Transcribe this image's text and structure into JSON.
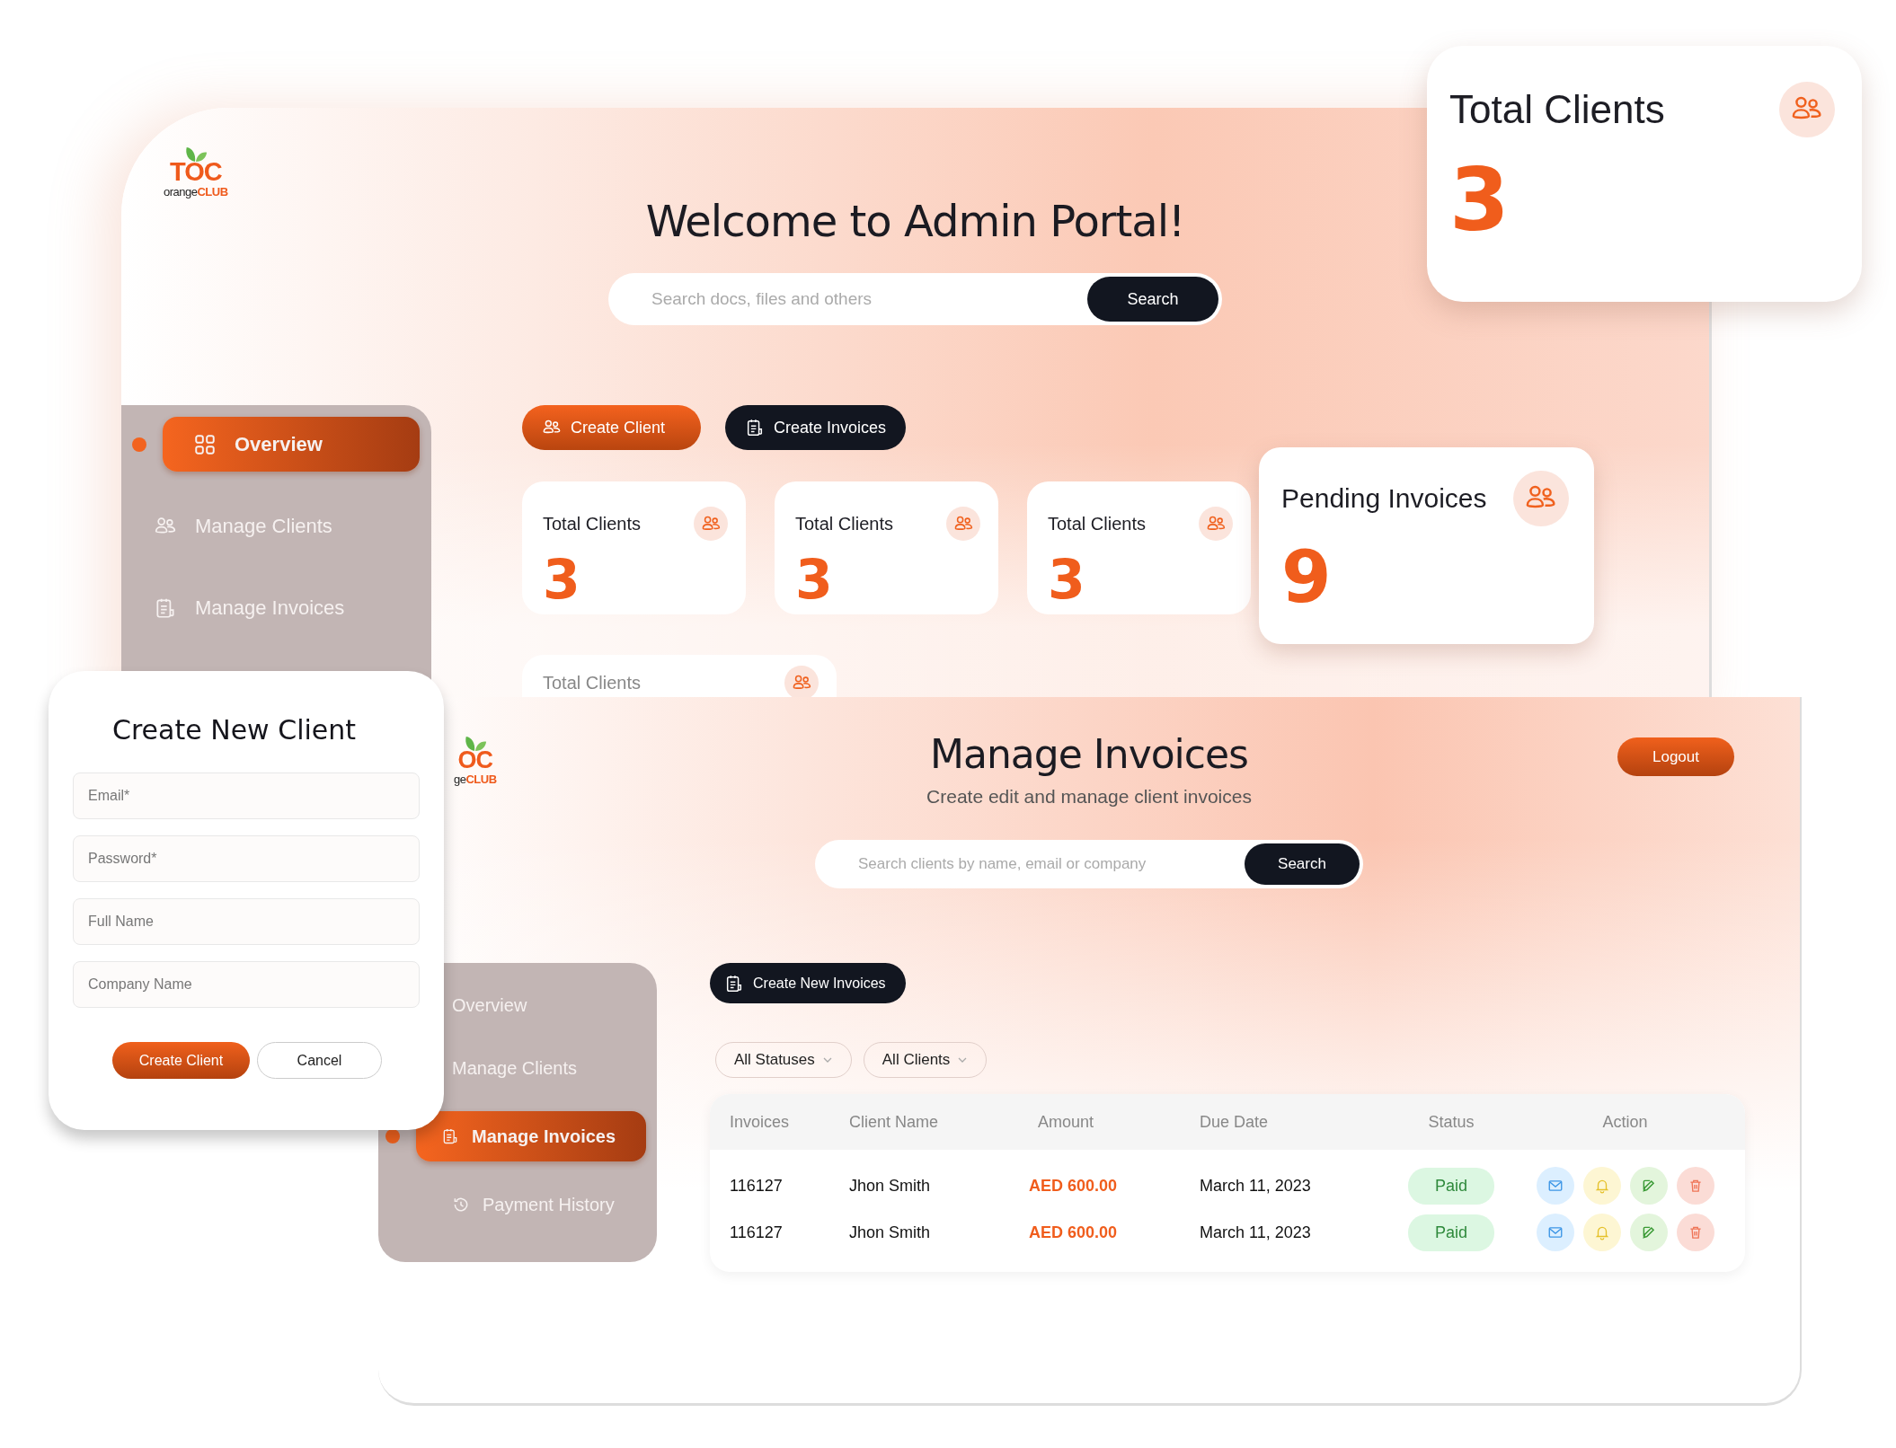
{
  "admin_portal": {
    "logo": {
      "mark": "TOC",
      "name": "orange",
      "name_accent": "CLUB"
    },
    "title": "Welcome to Admin Portal!",
    "search": {
      "placeholder": "Search docs, files and others",
      "button": "Search"
    },
    "sidebar": {
      "items": [
        {
          "label": "Overview",
          "selected": true
        },
        {
          "label": "Manage Clients",
          "selected": false
        },
        {
          "label": "Manage Invoices",
          "selected": false
        }
      ]
    },
    "actions": [
      {
        "label": "Create Client",
        "kind": "primary"
      },
      {
        "label": "Create Invoices",
        "kind": "dark"
      }
    ],
    "stat_cards": [
      {
        "label": "Total Clients",
        "value": "3"
      },
      {
        "label": "Total Clients",
        "value": "3"
      },
      {
        "label": "Total Clients",
        "value": "3"
      }
    ],
    "pending_card": {
      "label": "Pending Invoices",
      "value": "9"
    },
    "partial_card": {
      "label": "Total Clients"
    }
  },
  "total_clients_card": {
    "label": "Total Clients",
    "value": "3"
  },
  "invoices_page": {
    "logo": {
      "mark": "OC",
      "name": "ge",
      "name_accent": "CLUB"
    },
    "title": "Manage Invoices",
    "subtitle": "Create edit and manage client invoices",
    "logout": "Logout",
    "search": {
      "placeholder": "Search clients by name, email or company",
      "button": "Search"
    },
    "sidebar": {
      "items": [
        {
          "label": "Overview",
          "selected": false
        },
        {
          "label": "Manage Clients",
          "selected": false
        },
        {
          "label": "Manage Invoices",
          "selected": true
        },
        {
          "label": "Payment History",
          "selected": false
        }
      ]
    },
    "create_button": "Create New Invoices",
    "filters": [
      "All Statuses",
      "All Clients"
    ],
    "table": {
      "columns": [
        "Invoices",
        "Client Name",
        "Amount",
        "Due Date",
        "Status",
        "Action"
      ],
      "rows": [
        {
          "invoice": "116127",
          "client": "Jhon Smith",
          "amount": "AED 600.00",
          "due_date": "March 11, 2023",
          "status": "Paid"
        },
        {
          "invoice": "116127",
          "client": "Jhon Smith",
          "amount": "AED 600.00",
          "due_date": "March 11, 2023",
          "status": "Paid"
        }
      ]
    }
  },
  "create_client_dialog": {
    "title": "Create New Client",
    "fields": [
      {
        "placeholder": "Email*"
      },
      {
        "placeholder": "Password*"
      },
      {
        "placeholder": "Full Name"
      },
      {
        "placeholder": "Company Name"
      }
    ],
    "buttons": [
      {
        "label": "Create Client",
        "kind": "primary"
      },
      {
        "label": "Cancel",
        "kind": "secondary"
      }
    ]
  }
}
